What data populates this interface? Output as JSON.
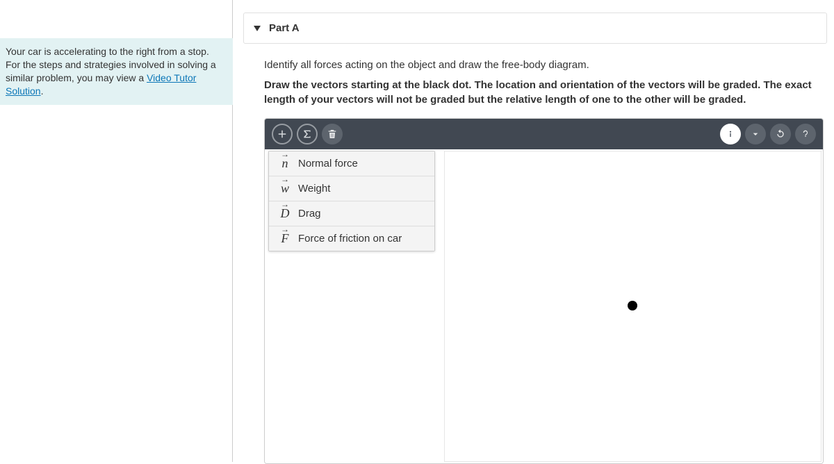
{
  "left": {
    "info_text_1": "Your car is accelerating to the right from a stop. For the steps and strategies involved in solving a similar problem, you may view a ",
    "link_text": "Video Tutor Solution",
    "info_text_2": "."
  },
  "part": {
    "label": "Part A"
  },
  "question": "Identify all forces acting on the object and draw the free-body diagram.",
  "instruction": "Draw the vectors starting at the black dot. The location and orientation of the vectors will be graded. The exact length of your vectors will not be graded but the relative length of one to the other will be graded.",
  "vectors": [
    {
      "symbol": "n",
      "label": "Normal force"
    },
    {
      "symbol": "w",
      "label": "Weight"
    },
    {
      "symbol": "D",
      "label": "Drag"
    },
    {
      "symbol": "F",
      "label": "Force of friction on car"
    }
  ]
}
